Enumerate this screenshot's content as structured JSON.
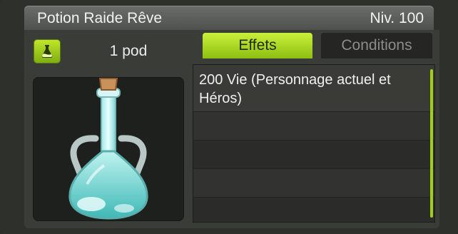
{
  "item": {
    "name": "Potion Raide Rêve",
    "level": "Niv. 100",
    "weight": "1 pod",
    "type_icon": "potion-type-icon"
  },
  "tabs": [
    {
      "label": "Effets",
      "active": true
    },
    {
      "label": "Conditions",
      "active": false
    }
  ],
  "effects": [
    "200 Vie (Personnage actuel et Héros)"
  ],
  "colors": {
    "accent": "#9cd114",
    "title_bar": "#5d5f5b",
    "panel": "#3a3c38",
    "text": "#f0f0f0"
  }
}
